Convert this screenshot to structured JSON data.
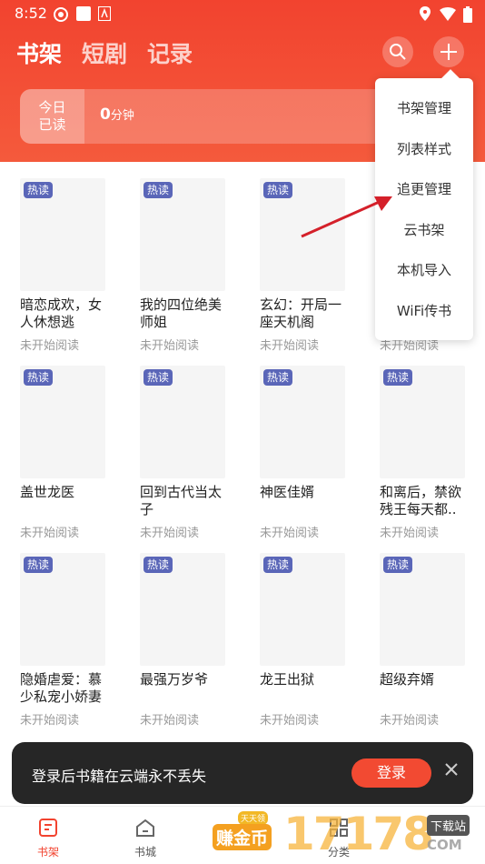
{
  "status": {
    "time": "8:52"
  },
  "header": {
    "tabs": [
      {
        "label": "书架"
      },
      {
        "label": "短剧"
      },
      {
        "label": "记录"
      }
    ],
    "reading": {
      "label_line1": "今日",
      "label_line2": "已读",
      "value": "0",
      "unit": "分钟"
    }
  },
  "menu": {
    "items": [
      {
        "label": "书架管理"
      },
      {
        "label": "列表样式"
      },
      {
        "label": "追更管理"
      },
      {
        "label": "云书架"
      },
      {
        "label": "本机导入"
      },
      {
        "label": "WiFi传书"
      }
    ]
  },
  "badge_label": "热读",
  "books": [
    {
      "title": "暗恋成欢，女人休想逃",
      "status": "未开始阅读"
    },
    {
      "title": "我的四位绝美师姐",
      "status": "未开始阅读"
    },
    {
      "title": "玄幻：开局一座天机阁",
      "status": "未开始阅读"
    },
    {
      "title": "",
      "status": "未开始阅读"
    },
    {
      "title": "盖世龙医",
      "status": "未开始阅读"
    },
    {
      "title": "回到古代当太子",
      "status": "未开始阅读"
    },
    {
      "title": "神医佳婿",
      "status": "未开始阅读"
    },
    {
      "title": "和离后，禁欲残王每天都..",
      "status": "未开始阅读"
    },
    {
      "title": "隐婚虐爱：慕少私宠小娇妻",
      "status": "未开始阅读"
    },
    {
      "title": "最强万岁爷",
      "status": "未开始阅读"
    },
    {
      "title": "龙王出狱",
      "status": "未开始阅读"
    },
    {
      "title": "超级弃婿",
      "status": "未开始阅读"
    }
  ],
  "toast": {
    "text": "登录后书籍在云端永不丢失",
    "button": "登录"
  },
  "tabbar": {
    "items": [
      {
        "label": "书架"
      },
      {
        "label": "书城"
      },
      {
        "label": "分类"
      }
    ],
    "coin_badge": "天天领",
    "coin_label": "赚金币"
  },
  "watermark": {
    "number": "17178",
    "badge": "下载站",
    "site": "COM"
  },
  "colors": {
    "accent": "#f2432f",
    "badge": "#5a66b8",
    "toast": "#262626"
  }
}
